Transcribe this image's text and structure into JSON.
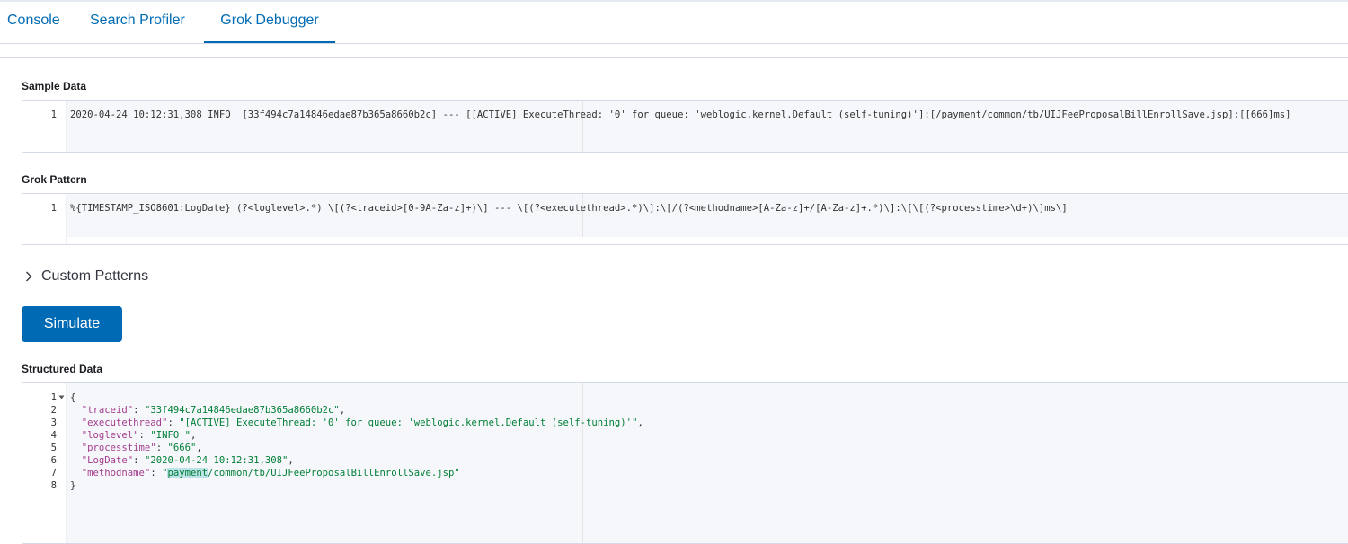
{
  "tabs": [
    {
      "label": "Console"
    },
    {
      "label": "Search Profiler"
    },
    {
      "label": "Grok Debugger"
    }
  ],
  "sample_data": {
    "label": "Sample Data",
    "line_number": "1",
    "text": "2020-04-24 10:12:31,308 INFO  [33f494c7a14846edae87b365a8660b2c] --- [[ACTIVE] ExecuteThread: '0' for queue: 'weblogic.kernel.Default (self-tuning)']:[/payment/common/tb/UIJFeeProposalBillEnrollSave.jsp]:[[666]ms]"
  },
  "grok_pattern": {
    "label": "Grok Pattern",
    "line_number": "1",
    "text": "%{TIMESTAMP_ISO8601:LogDate} (?<loglevel>.*) \\[(?<traceid>[0-9A-Za-z]+)\\] --- \\[(?<executethread>.*)\\]:\\[/(?<methodname>[A-Za-z]+/[A-Za-z]+.*)\\]:\\[\\[(?<processtime>\\d+)\\]ms\\]"
  },
  "custom_patterns": {
    "label": "Custom Patterns"
  },
  "simulate_button": {
    "label": "Simulate"
  },
  "structured_data": {
    "label": "Structured Data",
    "line_numbers": [
      "1",
      "2",
      "3",
      "4",
      "5",
      "6",
      "7",
      "8"
    ],
    "open_brace": "{",
    "close_brace": "}",
    "fields": [
      {
        "key": "\"traceid\"",
        "value": "\"33f494c7a14846edae87b365a8660b2c\"",
        "comma": ","
      },
      {
        "key": "\"executethread\"",
        "value": "\"[ACTIVE] ExecuteThread: '0' for queue: 'weblogic.kernel.Default (self-tuning)'\"",
        "comma": ","
      },
      {
        "key": "\"loglevel\"",
        "value": "\"INFO \"",
        "comma": ","
      },
      {
        "key": "\"processtime\"",
        "value": "\"666\"",
        "comma": ","
      },
      {
        "key": "\"LogDate\"",
        "value": "\"2020-04-24 10:12:31,308\"",
        "comma": ","
      },
      {
        "key": "\"methodname\"",
        "value_prefix": "\"",
        "value_highlight": "payment",
        "value_rest": "/common/tb/UIJFeeProposalBillEnrollSave.jsp\"",
        "comma": ""
      }
    ]
  },
  "colors": {
    "accent": "#006bb4",
    "json_key": "#a33c8d",
    "json_string": "#017f37"
  }
}
